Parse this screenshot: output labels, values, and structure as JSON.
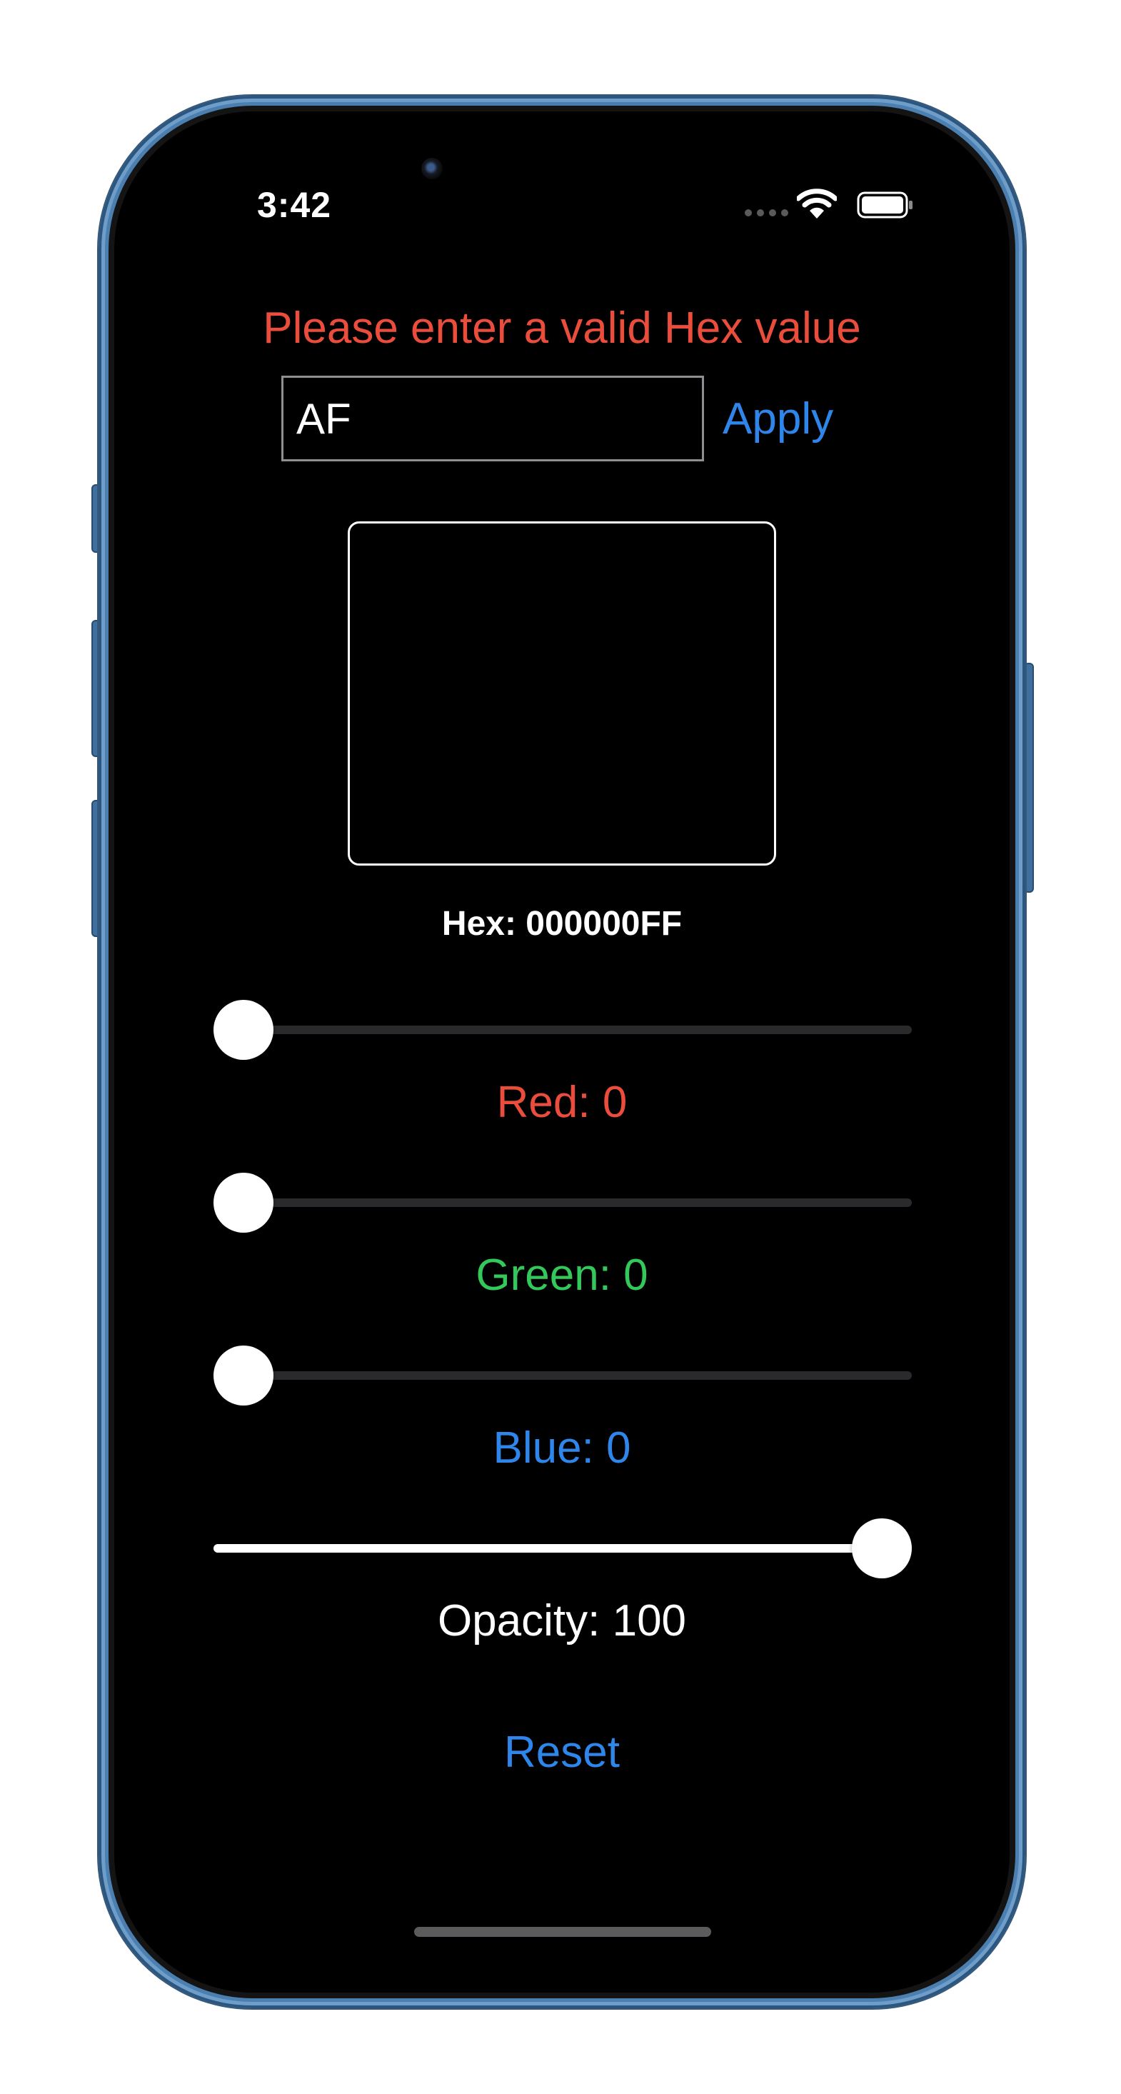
{
  "status_bar": {
    "time": "3:42"
  },
  "error_message": "Please enter a valid Hex value",
  "hex_input": {
    "value": "AF"
  },
  "apply_label": "Apply",
  "hex_display": "Hex: 000000FF",
  "sliders": {
    "red": {
      "label": "Red: 0",
      "value": 0,
      "max": 255,
      "color": "#eb4d3d"
    },
    "green": {
      "label": "Green: 0",
      "value": 0,
      "max": 255,
      "color": "#34c759"
    },
    "blue": {
      "label": "Blue: 0",
      "value": 0,
      "max": 255,
      "color": "#2f86ea"
    },
    "opacity": {
      "label": "Opacity: 100",
      "value": 100,
      "max": 100,
      "color": "#ffffff"
    }
  },
  "reset_label": "Reset",
  "colors": {
    "error": "#eb4d3d",
    "accent": "#2f86ea",
    "green": "#34c759",
    "background": "#000000",
    "phone_frame": "#4b7fb0"
  }
}
